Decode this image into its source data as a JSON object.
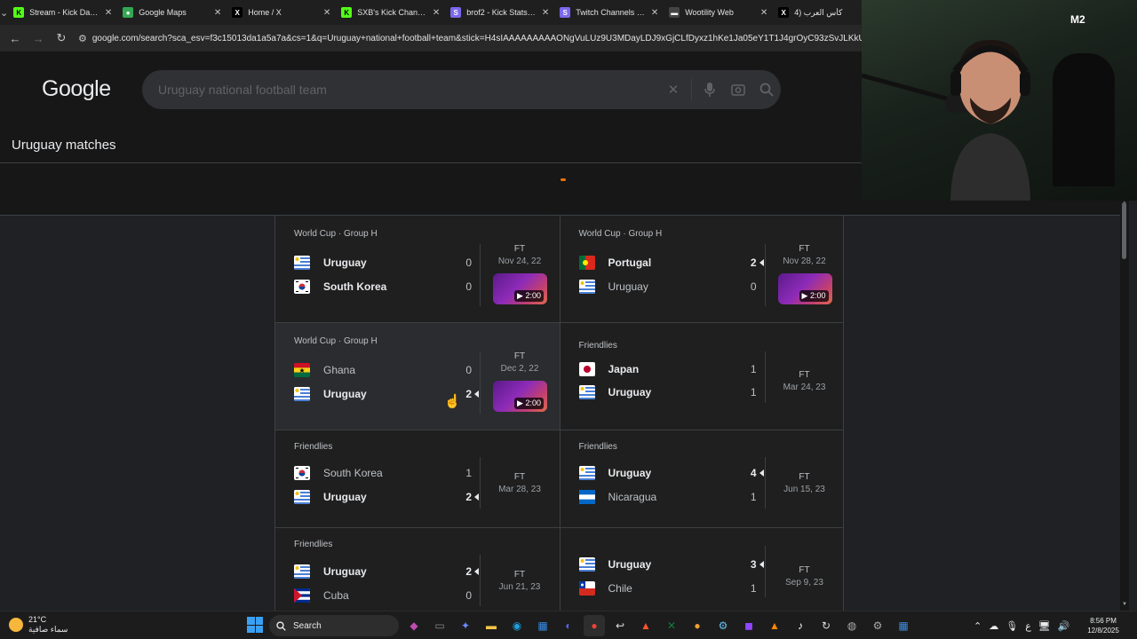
{
  "browser": {
    "tabs": [
      {
        "title": "Stream - Kick Dashbo",
        "icon": "kick-icon",
        "color": "#53fc18",
        "glyph": "K"
      },
      {
        "title": "Google Maps",
        "icon": "maps-pin-icon",
        "color": "#34a853",
        "glyph": "●"
      },
      {
        "title": "Home / X",
        "icon": "x-icon",
        "color": "#000000",
        "glyph": "X"
      },
      {
        "title": "SXB's Kick Channel St",
        "icon": "kick-icon",
        "color": "#53fc18",
        "glyph": "K"
      },
      {
        "title": "brof2 - Kick Stats, An",
        "icon": "stats-icon",
        "color": "#7b68ee",
        "glyph": "S"
      },
      {
        "title": "Twitch Channels Com",
        "icon": "stats-icon",
        "color": "#7b68ee",
        "glyph": "S"
      },
      {
        "title": "Wootility Web",
        "icon": "wooting-icon",
        "color": "#444444",
        "glyph": "▬"
      },
      {
        "title": "كأس العرب (4",
        "icon": "x-icon",
        "color": "#000000",
        "glyph": "X"
      }
    ],
    "url": "google.com/search?sca_esv=f3c15013da1a5a7a&cs=1&q=Uruguay+national+football+team&stick=H4sIAAAAAAAAAONgVuLUz9U3MDayLDJ9xGjCLfDyxz1hKe1Ja05eY1T1J4grOyC93zSvJLKkUEudig7J4pbi5ELp4F"
  },
  "search": {
    "logo": "Google",
    "query": "Uruguay national football team"
  },
  "section_title": "Uruguay matches",
  "matches": [
    {
      "competition": "World Cup · Group H",
      "teams": [
        {
          "name": "Uruguay",
          "score": "0",
          "flag": "uruguay",
          "winner": false,
          "bold": true
        },
        {
          "name": "South Korea",
          "score": "0",
          "flag": "south-korea",
          "winner": false,
          "bold": true
        }
      ],
      "status": "FT",
      "date": "Nov 24, 22",
      "video": "2:00"
    },
    {
      "competition": "World Cup · Group H",
      "teams": [
        {
          "name": "Portugal",
          "score": "2",
          "flag": "portugal",
          "winner": true,
          "bold": true
        },
        {
          "name": "Uruguay",
          "score": "0",
          "flag": "uruguay",
          "winner": false,
          "bold": false
        }
      ],
      "status": "FT",
      "date": "Nov 28, 22",
      "video": "2:00"
    },
    {
      "competition": "World Cup · Group H",
      "teams": [
        {
          "name": "Ghana",
          "score": "0",
          "flag": "ghana",
          "winner": false,
          "bold": false
        },
        {
          "name": "Uruguay",
          "score": "2",
          "flag": "uruguay",
          "winner": true,
          "bold": true
        }
      ],
      "status": "FT",
      "date": "Dec 2, 22",
      "video": "2:00"
    },
    {
      "competition": "Friendlies",
      "teams": [
        {
          "name": "Japan",
          "score": "1",
          "flag": "japan",
          "winner": false,
          "bold": true
        },
        {
          "name": "Uruguay",
          "score": "1",
          "flag": "uruguay",
          "winner": false,
          "bold": true
        }
      ],
      "status": "FT",
      "date": "Mar 24, 23",
      "video": ""
    },
    {
      "competition": "Friendlies",
      "teams": [
        {
          "name": "South Korea",
          "score": "1",
          "flag": "south-korea",
          "winner": false,
          "bold": false
        },
        {
          "name": "Uruguay",
          "score": "2",
          "flag": "uruguay",
          "winner": true,
          "bold": true
        }
      ],
      "status": "FT",
      "date": "Mar 28, 23",
      "video": ""
    },
    {
      "competition": "Friendlies",
      "teams": [
        {
          "name": "Uruguay",
          "score": "4",
          "flag": "uruguay",
          "winner": true,
          "bold": true
        },
        {
          "name": "Nicaragua",
          "score": "1",
          "flag": "nicaragua",
          "winner": false,
          "bold": false
        }
      ],
      "status": "FT",
      "date": "Jun 15, 23",
      "video": ""
    },
    {
      "competition": "Friendlies",
      "teams": [
        {
          "name": "Uruguay",
          "score": "2",
          "flag": "uruguay",
          "winner": true,
          "bold": true
        },
        {
          "name": "Cuba",
          "score": "0",
          "flag": "cuba",
          "winner": false,
          "bold": false
        }
      ],
      "status": "FT",
      "date": "Jun 21, 23",
      "video": ""
    },
    {
      "competition": "",
      "teams": [
        {
          "name": "Uruguay",
          "score": "3",
          "flag": "uruguay",
          "winner": true,
          "bold": true
        },
        {
          "name": "Chile",
          "score": "1",
          "flag": "chile",
          "winner": false,
          "bold": false
        }
      ],
      "status": "FT",
      "date": "Sep 9, 23",
      "video": ""
    }
  ],
  "webcam": {
    "badge": "M2"
  },
  "taskbar": {
    "weather_temp": "21°C",
    "weather_desc": "سماء صافية",
    "weather_alert": "1",
    "search_label": "Search",
    "lang": "ع",
    "time": "8:56 PM",
    "date": "12/8/2025"
  }
}
